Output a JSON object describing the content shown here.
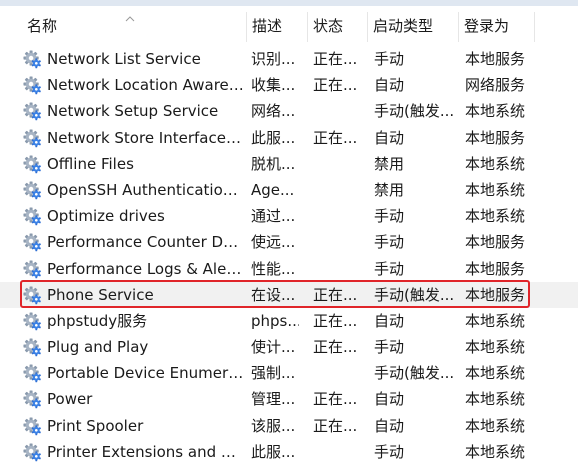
{
  "columns": {
    "name": "名称",
    "description": "描述",
    "status": "状态",
    "startup_type": "启动类型",
    "logon_as": "登录为"
  },
  "sort_indicator": "sort-ascending-icon",
  "colors": {
    "selection_outline": "#e0252a",
    "selected_row_bg": "#f1f1f1",
    "gear_blue": "#2f6fd3"
  },
  "services": [
    {
      "name": "Network List Service",
      "description": "识别...",
      "status": "正在...",
      "startup_type": "手动",
      "logon_as": "本地服务"
    },
    {
      "name": "Network Location Awarene...",
      "description": "收集...",
      "status": "正在...",
      "startup_type": "自动",
      "logon_as": "网络服务"
    },
    {
      "name": "Network Setup Service",
      "description": "网络...",
      "status": "",
      "startup_type": "手动(触发...",
      "logon_as": "本地系统"
    },
    {
      "name": "Network Store Interface Se...",
      "description": "此服...",
      "status": "正在...",
      "startup_type": "自动",
      "logon_as": "本地服务"
    },
    {
      "name": "Offline Files",
      "description": "脱机...",
      "status": "",
      "startup_type": "禁用",
      "logon_as": "本地系统"
    },
    {
      "name": "OpenSSH Authentication ...",
      "description": "Age...",
      "status": "",
      "startup_type": "禁用",
      "logon_as": "本地系统"
    },
    {
      "name": "Optimize drives",
      "description": "通过...",
      "status": "",
      "startup_type": "手动",
      "logon_as": "本地系统"
    },
    {
      "name": "Performance Counter DLL ...",
      "description": "使远...",
      "status": "",
      "startup_type": "手动",
      "logon_as": "本地服务"
    },
    {
      "name": "Performance Logs & Alerts",
      "description": "性能...",
      "status": "",
      "startup_type": "手动",
      "logon_as": "本地服务"
    },
    {
      "name": "Phone Service",
      "description": "在设...",
      "status": "正在...",
      "startup_type": "手动(触发...",
      "logon_as": "本地服务"
    },
    {
      "name": "phpstudy服务",
      "description": "phps...",
      "status": "正在...",
      "startup_type": "自动",
      "logon_as": "本地系统"
    },
    {
      "name": "Plug and Play",
      "description": "使计...",
      "status": "正在...",
      "startup_type": "手动",
      "logon_as": "本地系统"
    },
    {
      "name": "Portable Device Enumerat...",
      "description": "强制...",
      "status": "",
      "startup_type": "手动(触发...",
      "logon_as": "本地系统"
    },
    {
      "name": "Power",
      "description": "管理...",
      "status": "正在...",
      "startup_type": "自动",
      "logon_as": "本地系统"
    },
    {
      "name": "Print Spooler",
      "description": "该服...",
      "status": "正在...",
      "startup_type": "自动",
      "logon_as": "本地系统"
    },
    {
      "name": "Printer Extensions and Noti...",
      "description": "此服...",
      "status": "",
      "startup_type": "手动",
      "logon_as": "本地系统"
    }
  ],
  "selected_index": 9
}
